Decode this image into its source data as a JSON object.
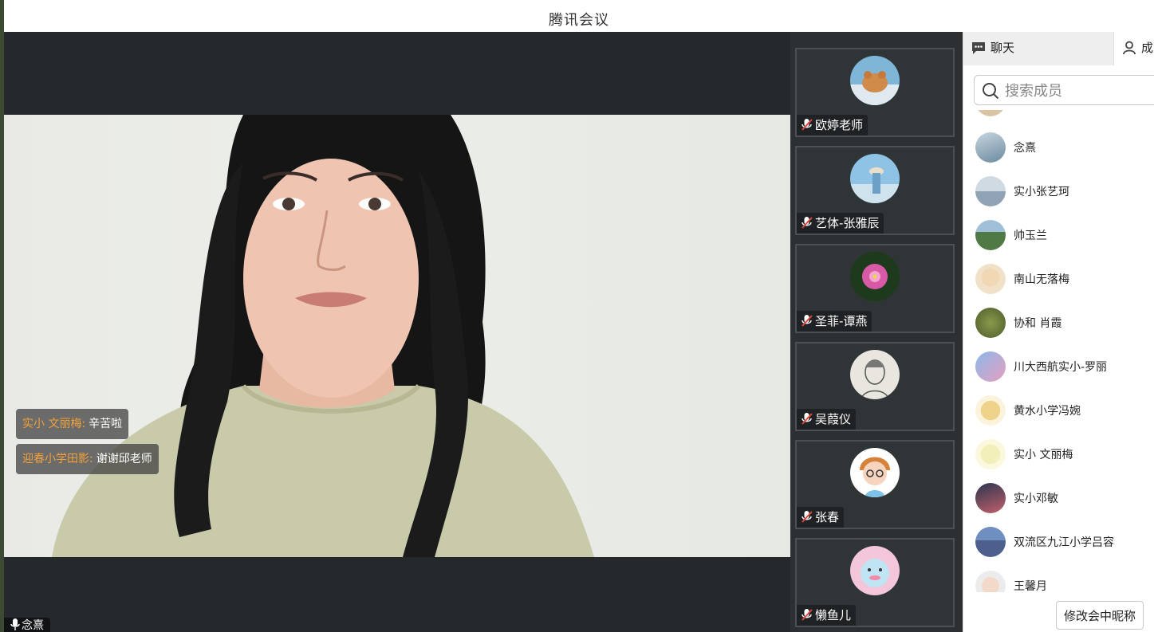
{
  "window": {
    "title": "腾讯会议"
  },
  "stage": {
    "chat_messages": [
      {
        "sender": "实小 文丽梅:",
        "text": "辛苦啦"
      },
      {
        "sender": "迎春小学田影:",
        "text": "谢谢邱老师"
      }
    ],
    "self_name": "念熹"
  },
  "participants": [
    {
      "name": "欧婷老师",
      "mic": "muted"
    },
    {
      "name": "艺体-张雅辰",
      "mic": "muted"
    },
    {
      "name": "圣菲-谭燕",
      "mic": "muted"
    },
    {
      "name": "吴葭仪",
      "mic": "muted"
    },
    {
      "name": "张春",
      "mic": "muted"
    },
    {
      "name": "懒鱼儿",
      "mic": "muted"
    }
  ],
  "panel": {
    "tabs": {
      "chat": "聊天",
      "members": "成员"
    },
    "search_placeholder": "搜索成员",
    "members": [
      "念熹",
      "实小张艺珂",
      "帅玉兰",
      "南山无落梅",
      "协和 肖霞",
      "川大西航实小-罗丽",
      "黄水小学冯婉",
      "实小 文丽梅",
      "实小邓敏",
      "双流区九江小学吕容",
      "王馨月"
    ],
    "rename_button": "修改会中昵称"
  },
  "colors": {
    "accent_orange": "#f2a03a",
    "stage_bg": "#25292c",
    "muted_red": "#e0463c"
  }
}
